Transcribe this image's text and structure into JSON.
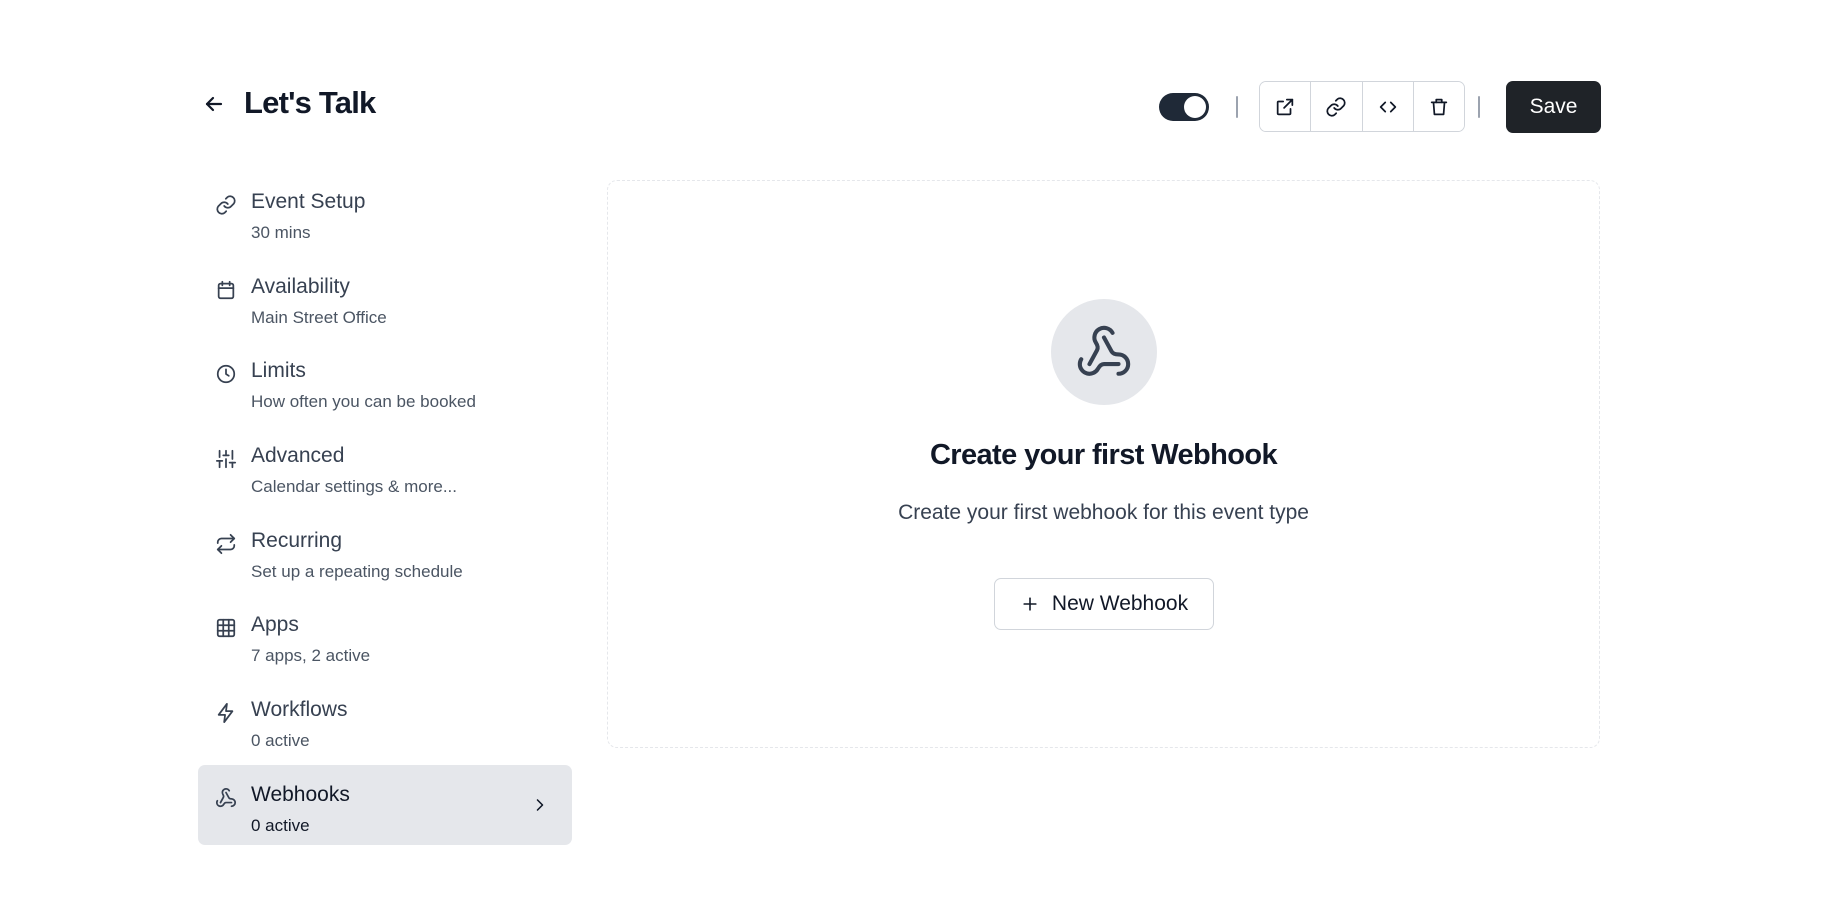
{
  "header": {
    "title": "Let's Talk",
    "toggle_on": true,
    "actions": [
      {
        "name": "preview-button",
        "icon": "external-link-icon"
      },
      {
        "name": "copy-link-button",
        "icon": "link-icon"
      },
      {
        "name": "embed-button",
        "icon": "code-icon"
      },
      {
        "name": "delete-button",
        "icon": "trash-icon"
      }
    ],
    "save_label": "Save"
  },
  "sidebar": {
    "items": [
      {
        "label": "Event Setup",
        "sub": "30 mins",
        "icon": "link-icon"
      },
      {
        "label": "Availability",
        "sub": "Main Street Office",
        "icon": "calendar-icon"
      },
      {
        "label": "Limits",
        "sub": "How often you can be booked",
        "icon": "clock-icon"
      },
      {
        "label": "Advanced",
        "sub": "Calendar settings & more...",
        "icon": "sliders-icon"
      },
      {
        "label": "Recurring",
        "sub": "Set up a repeating schedule",
        "icon": "repeat-icon"
      },
      {
        "label": "Apps",
        "sub": "7 apps, 2 active",
        "icon": "grid-icon"
      },
      {
        "label": "Workflows",
        "sub": "0 active",
        "icon": "zap-icon"
      },
      {
        "label": "Webhooks",
        "sub": "0 active",
        "icon": "webhook-icon",
        "active": true
      }
    ]
  },
  "main": {
    "empty_state": {
      "icon": "webhook-icon",
      "title": "Create your first Webhook",
      "description": "Create your first webhook for this event type",
      "button_label": "New Webhook"
    }
  },
  "colors": {
    "primary": "#1f2328",
    "active_bg": "#e5e7eb",
    "border": "#d1d5db",
    "text": "#111827",
    "muted": "#4b5563"
  }
}
